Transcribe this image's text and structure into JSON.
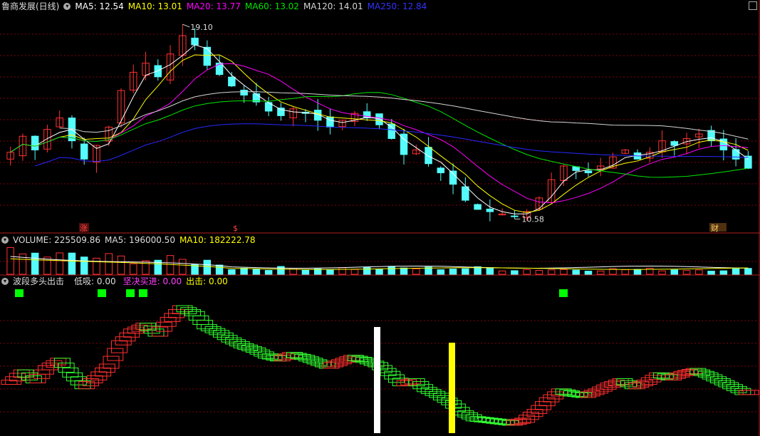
{
  "colors": {
    "up": "#ff3232",
    "down": "#54fcfc",
    "ma5": "#ffffff",
    "ma10": "#ffff00",
    "ma20": "#ff00ff",
    "ma60": "#00e600",
    "ma120": "#d4d4d4",
    "ma250": "#2828ff",
    "grid": "#80000f",
    "sep": "#b41e1e",
    "wave_up": "#ff3030",
    "wave_down": "#30ff30",
    "signal_green": "#00ff00",
    "bar_white": "#ffffff",
    "bar_yellow": "#ffff00"
  },
  "price_panel": {
    "title": "鲁商发展(日线)",
    "ma5": "MA5: 12.54",
    "ma10": "MA10: 13.01",
    "ma20": "MA20: 13.77",
    "ma60": "MA60: 13.02",
    "ma120": "MA120: 14.01",
    "ma250": "MA250: 12.84",
    "high_label": "19.10",
    "low_label": "10.58",
    "marker_zhang": "涨",
    "marker_dollar": "$",
    "marker_caicai": "财"
  },
  "volume_panel": {
    "label": "VOLUME: 225509.86",
    "ma5": "MA5: 196000.50",
    "ma10": "MA10: 182222.78"
  },
  "indicator_panel": {
    "name": "波段多头出击",
    "dixi": "低吸: 0.00",
    "jianjue": "坚决买进: 0.00",
    "chuji": "出击: 0.00"
  },
  "chart_data": {
    "type": "candlestick",
    "title": "鲁商发展(日线)",
    "high_marked": 19.1,
    "low_marked": 10.58,
    "close_approx": [
      13.5,
      14.2,
      13.6,
      14.5,
      15.0,
      14.0,
      13.2,
      13.8,
      14.6,
      16.2,
      17.0,
      17.4,
      16.8,
      17.8,
      18.6,
      18.2,
      17.3,
      16.9,
      16.4,
      16.0,
      15.7,
      15.3,
      15.1,
      15.4,
      15.2,
      14.9,
      14.6,
      14.9,
      15.2,
      15.0,
      14.7,
      14.1,
      13.4,
      13.6,
      13.0,
      12.6,
      12.1,
      11.4,
      11.0,
      10.9,
      10.8,
      10.7,
      10.9,
      11.5,
      12.3,
      12.9,
      12.7,
      12.6,
      12.9,
      13.3,
      13.6,
      13.2,
      13.5,
      14.0,
      13.8,
      14.1,
      14.3,
      14.0,
      13.6,
      13.2,
      12.8
    ]
  }
}
